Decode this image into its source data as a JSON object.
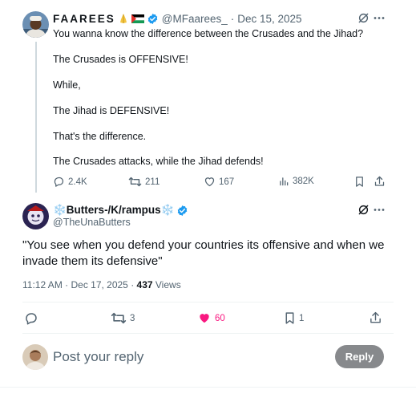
{
  "tweet1": {
    "author_name": "FAAREES",
    "emoji_icons": [
      "prayer-hands-icon",
      "palestine-flag-icon"
    ],
    "handle": "@MFaarees_",
    "separator": "·",
    "date": "Dec 15, 2025",
    "lines": [
      "You wanna know the difference between the Crusades and the Jihad?",
      "The Crusades is OFFENSIVE!",
      "While,",
      "The Jihad is DEFENSIVE!",
      "That's the difference.",
      "The Crusades attacks, while the Jihad defends!"
    ],
    "replies": "2.4K",
    "reposts": "211",
    "likes": "167",
    "views": "382K"
  },
  "tweet2": {
    "author_name": "❄️Butters-/K/rampus❄️",
    "handle": "@TheUnaButters",
    "text": "\"You see when you defend your countries its offensive and when we invade them its defensive\"",
    "time": "11:12 AM · Dec 17, 2025 · ",
    "views_count": "437",
    "views_label": " Views",
    "reposts": "3",
    "likes": "60",
    "bookmarks": "1",
    "liked": true
  },
  "composer": {
    "placeholder": "Post your reply",
    "button_label": "Reply"
  },
  "colors": {
    "verified": "#1d9bf0",
    "like_active": "#f91880",
    "muted_text": "#536471",
    "reply_button": "#87898c"
  }
}
